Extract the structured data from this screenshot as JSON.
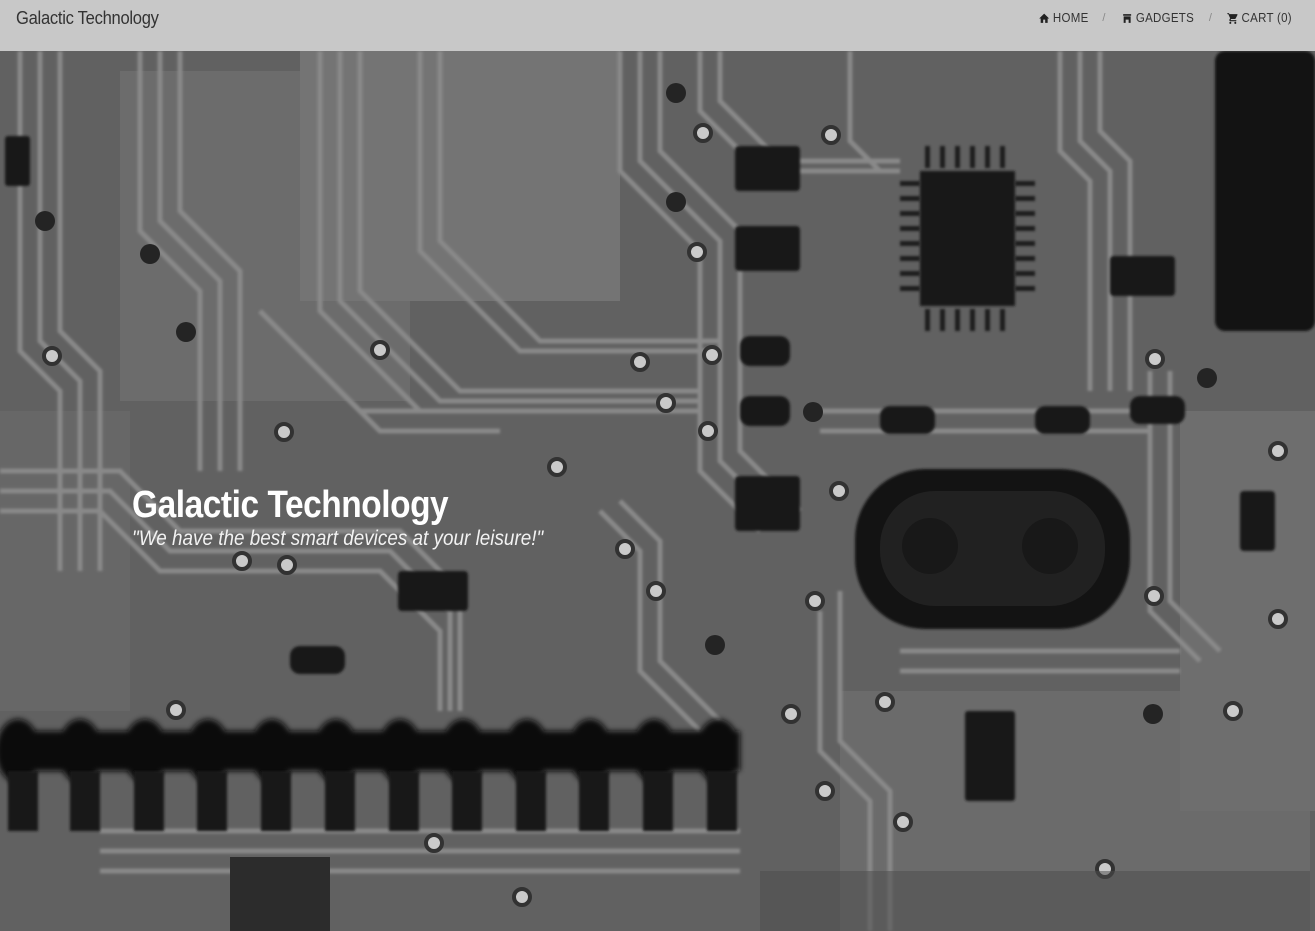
{
  "navbar": {
    "brand": "Galactic Technology",
    "links": [
      {
        "label": "HOME",
        "icon": "home-icon"
      },
      {
        "label": "GADGETS",
        "icon": "store-icon"
      },
      {
        "label": "CART (0)",
        "icon": "cart-icon"
      }
    ],
    "separator": "/",
    "background": "#c8c8c8"
  },
  "hero": {
    "title": "Galactic Technology",
    "tagline": "\"We have the best smart devices at your leisure!\"",
    "background_image": "grayscale-circuit-board"
  }
}
